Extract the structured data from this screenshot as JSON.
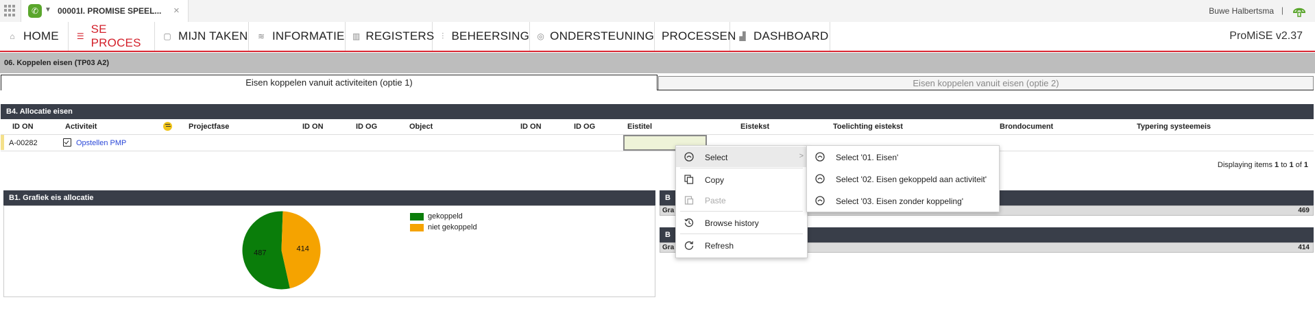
{
  "topbar": {
    "tab_title": "00001I. PROMISE SPEEL...",
    "user_name": "Buwe Halbertsma",
    "separator": "|",
    "close_glyph": "×",
    "icons": {
      "apps": "grid-icon",
      "logo": "phone-logo-icon",
      "caret": "chevron-down-icon",
      "user": "phone-user-icon"
    }
  },
  "nav": {
    "items": [
      {
        "label": "HOME",
        "icon": "home-icon"
      },
      {
        "label": "SE PROCES",
        "icon": "list-icon"
      },
      {
        "label": "MIJN TAKEN",
        "icon": "clipboard-icon"
      },
      {
        "label": "INFORMATIE",
        "icon": "layers-icon"
      },
      {
        "label": "REGISTERS",
        "icon": "book-icon"
      },
      {
        "label": "BEHEERSING",
        "icon": "sliders-icon"
      },
      {
        "label": "ONDERSTEUNING",
        "icon": "lifebuoy-icon"
      },
      {
        "label": "PROCESSEN",
        "icon": ""
      },
      {
        "label": "DASHBOARD",
        "icon": "bar-chart-icon"
      }
    ],
    "active": "SE PROCES",
    "brand": "ProMiSE v2.37",
    "accent": "#d31f2a"
  },
  "breadcrumb": "06. Koppelen eisen (TP03 A2)",
  "options": {
    "active": "Eisen koppelen vanuit activiteiten (optie 1)",
    "inactive": "Eisen koppelen vanuit eisen (optie 2)"
  },
  "b4": {
    "title": "B4. Allocatie eisen",
    "columns": [
      "ID ON",
      "Activiteit",
      "Projectfase",
      "ID ON",
      "ID OG",
      "Object",
      "ID ON",
      "ID OG",
      "Eistitel",
      "Eistekst",
      "Toelichting eistekst",
      "Brondocument",
      "Typering systeemeis"
    ],
    "row": {
      "id": "A-00282",
      "activity": "Opstellen PMP"
    },
    "display": {
      "prefix": "Displaying items ",
      "from": "1",
      "to_word": " to ",
      "to": "1",
      "of_word": " of ",
      "total": "1"
    }
  },
  "b1": {
    "title": "B1. Grafiek eis allocatie",
    "chart_data": {
      "type": "pie",
      "slices": [
        {
          "label": "gekoppeld",
          "value": 487,
          "color": "#0a7d0a"
        },
        {
          "label": "niet gekoppeld",
          "value": 414,
          "color": "#f5a300"
        }
      ]
    }
  },
  "right_panels": [
    {
      "head": "B",
      "bar_label": "Gra",
      "value": "469"
    },
    {
      "head": "B",
      "bar_label": "Gra",
      "value": "414"
    }
  ],
  "context_menu": {
    "items": [
      {
        "label": "Select",
        "icon": "select-icon",
        "submenu_arrow": ">"
      },
      {
        "label": "Copy",
        "icon": "copy-icon"
      },
      {
        "label": "Paste",
        "icon": "paste-icon",
        "disabled": true
      },
      {
        "label": "Browse history",
        "icon": "history-icon"
      },
      {
        "label": "Refresh",
        "icon": "refresh-icon"
      }
    ],
    "submenu": [
      {
        "label": "Select '01. Eisen'",
        "icon": "select-icon"
      },
      {
        "label": "Select '02. Eisen gekoppeld aan activiteit'",
        "icon": "select-icon"
      },
      {
        "label": "Select '03. Eisen zonder koppeling'",
        "icon": "select-icon"
      }
    ]
  }
}
